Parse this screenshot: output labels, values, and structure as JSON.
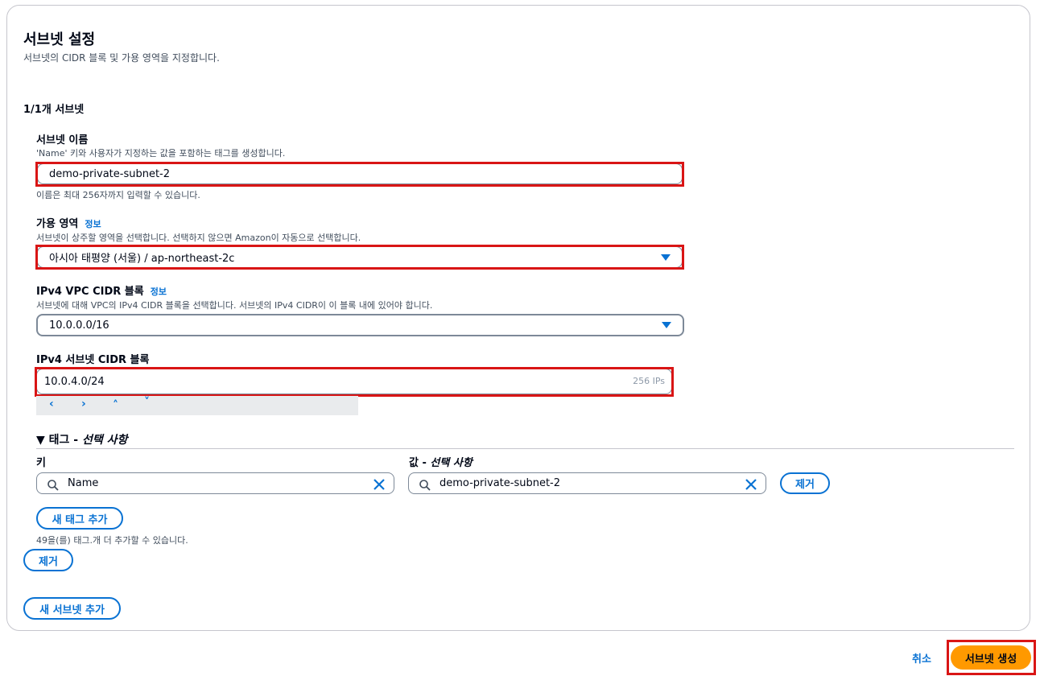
{
  "section": {
    "title": "서브넷 설정",
    "description": "서브넷의 CIDR 블록 및 가용 영역을 지정합니다."
  },
  "subnet_counter": "1/1개 서브넷",
  "subnet_name": {
    "label": "서브넷 이름",
    "description": "'Name' 키와 사용자가 지정하는 값을 포함하는 태그를 생성합니다.",
    "value": "demo-private-subnet-2",
    "hint": "이름은 최대 256자까지 입력할 수 있습니다."
  },
  "availability_zone": {
    "label": "가용 영역",
    "info": "정보",
    "description": "서브넷이 상주할 영역을 선택합니다. 선택하지 않으면 Amazon이 자동으로 선택합니다.",
    "value": "아시아 태평양 (서울) / ap-northeast-2c"
  },
  "vpc_cidr": {
    "label": "IPv4 VPC CIDR 블록",
    "info": "정보",
    "description": "서브넷에 대해 VPC의 IPv4 CIDR 블록을 선택합니다. 서브넷의 IPv4 CIDR이 이 블록 내에 있어야 합니다.",
    "value": "10.0.0.0/16"
  },
  "subnet_cidr": {
    "label": "IPv4 서브넷 CIDR 블록",
    "value": "10.0.4.0/24",
    "ip_count": "256 IPs",
    "stepper": [
      "‹",
      "›",
      "˄",
      "˅"
    ]
  },
  "tags": {
    "toggle": "▼",
    "title": "태그 - ",
    "title_optional": "선택 사항",
    "key_label": "키",
    "value_label": "값 - ",
    "value_optional": "선택 사항",
    "key": "Name",
    "value": "demo-private-subnet-2",
    "remove_label": "제거",
    "add_label": "새 태그 추가",
    "limit_note": "49을(를) 태그.개 더 추가할 수 있습니다."
  },
  "remove_subnet_label": "제거",
  "add_subnet_label": "새 서브넷 추가",
  "footer": {
    "cancel": "취소",
    "create": "서브넷 생성"
  },
  "colors": {
    "accent": "#0972d3",
    "primary_button": "#ff9900",
    "highlight": "#d91515"
  }
}
